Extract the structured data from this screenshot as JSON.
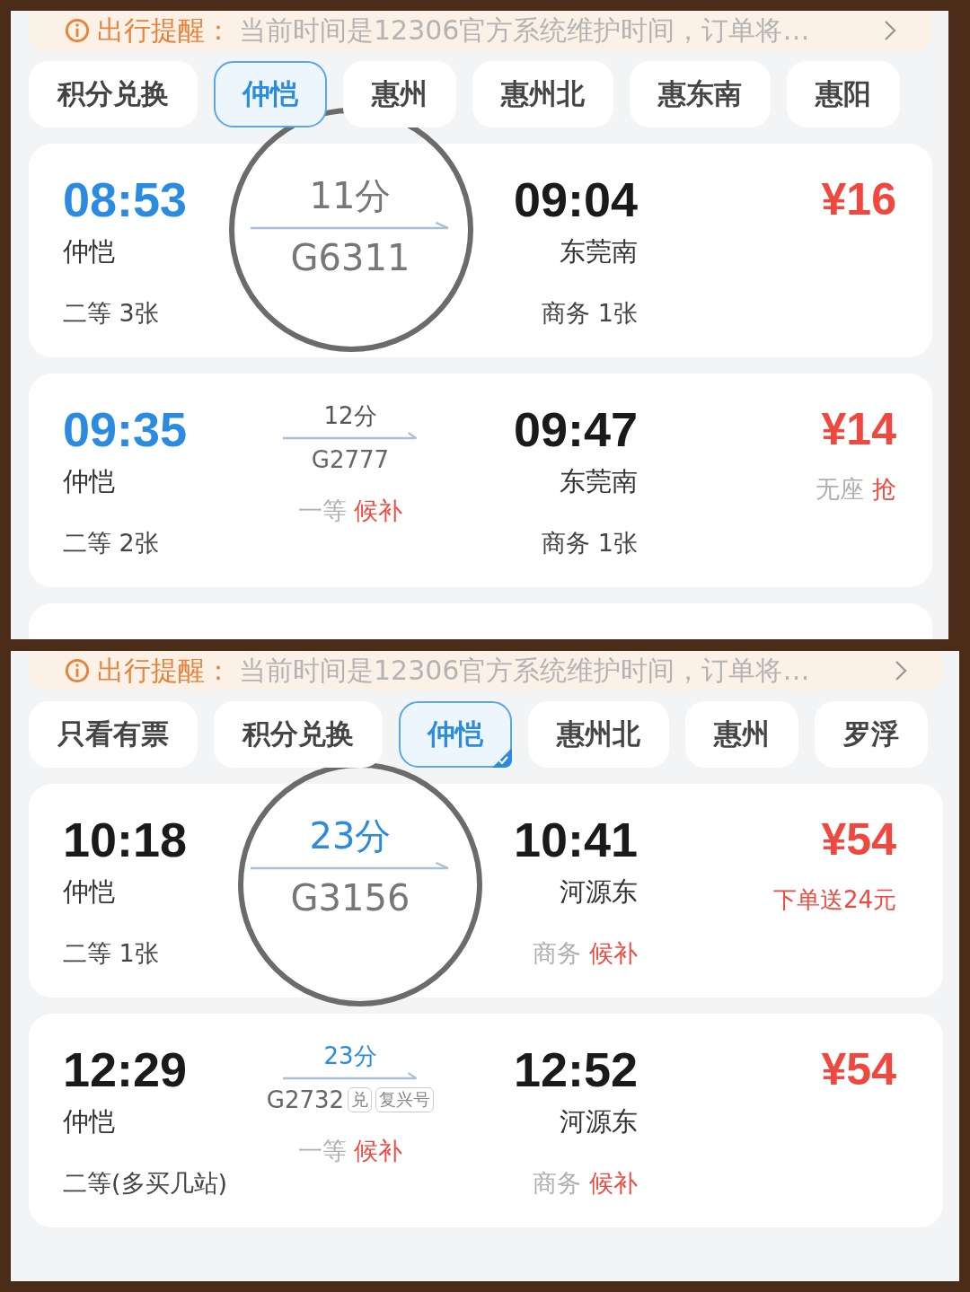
{
  "panels": [
    {
      "notice": {
        "label": "出行提醒：",
        "text": "当前时间是12306官方系统维护时间，订单将…"
      },
      "tabs": [
        {
          "label": "积分兑换",
          "selected": false,
          "badge": false
        },
        {
          "label": "仲恺",
          "selected": true,
          "badge": false
        },
        {
          "label": "惠州",
          "selected": false,
          "badge": false
        },
        {
          "label": "惠州北",
          "selected": false,
          "badge": false
        },
        {
          "label": "惠东南",
          "selected": false,
          "badge": false
        },
        {
          "label": "惠阳",
          "selected": false,
          "badge": false
        }
      ],
      "trains": [
        {
          "kind": "train",
          "zoomed": true,
          "depart": {
            "time": "08:53",
            "station": "仲恺",
            "origin": true,
            "seat": {
              "class": "二等",
              "status": "3张",
              "waitlist": false
            }
          },
          "duration": "11分",
          "duration_highlight": false,
          "number": "G6311",
          "arrive": {
            "time": "09:04",
            "station": "东莞南",
            "seat": {
              "class": "商务",
              "status": "1张",
              "waitlist": false
            }
          },
          "price": "¥16"
        },
        {
          "kind": "train",
          "zoomed": false,
          "depart": {
            "time": "09:35",
            "station": "仲恺",
            "origin": true,
            "seat": {
              "class": "二等",
              "status": "2张",
              "waitlist": false
            }
          },
          "duration": "12分",
          "duration_highlight": false,
          "number": "G2777",
          "middle_seat": {
            "class": "一等",
            "status": "候补",
            "waitlist": true
          },
          "arrive": {
            "time": "09:47",
            "station": "东莞南",
            "seat": {
              "class": "商务",
              "status": "1张",
              "waitlist": false
            }
          },
          "price": "¥14",
          "price_note": {
            "kind": "seat",
            "class": "无座",
            "status": "抢",
            "waitlist": true
          }
        },
        {
          "kind": "stub"
        }
      ]
    },
    {
      "notice": {
        "label": "出行提醒：",
        "text": "当前时间是12306官方系统维护时间，订单将…"
      },
      "tabs": [
        {
          "label": "只看有票",
          "selected": false,
          "badge": false
        },
        {
          "label": "积分兑换",
          "selected": false,
          "badge": false
        },
        {
          "label": "仲恺",
          "selected": true,
          "badge": true
        },
        {
          "label": "惠州北",
          "selected": false,
          "badge": false
        },
        {
          "label": "惠州",
          "selected": false,
          "badge": false
        },
        {
          "label": "罗浮",
          "selected": false,
          "badge": false
        }
      ],
      "trains": [
        {
          "kind": "train",
          "zoomed": true,
          "depart": {
            "time": "10:18",
            "station": "仲恺",
            "origin": false,
            "seat": {
              "class": "二等",
              "status": "1张",
              "waitlist": false
            }
          },
          "duration": "23分",
          "duration_highlight": true,
          "number": "G3156",
          "arrive": {
            "time": "10:41",
            "station": "河源东",
            "seat": {
              "class": "商务",
              "status": "候补",
              "waitlist": true
            }
          },
          "price": "¥54",
          "price_note": {
            "kind": "promo",
            "text": "下单送24元"
          }
        },
        {
          "kind": "train",
          "zoomed": false,
          "depart": {
            "time": "12:29",
            "station": "仲恺",
            "origin": false,
            "seat": {
              "class": "二等(多买几站)",
              "waitlist": false
            }
          },
          "duration": "23分",
          "duration_highlight": true,
          "number": "G2732",
          "tags": [
            "兑",
            "复兴号"
          ],
          "middle_seat": {
            "class": "一等",
            "status": "候补",
            "waitlist": true
          },
          "arrive": {
            "time": "12:52",
            "station": "河源东",
            "seat": {
              "class": "商务",
              "status": "候补",
              "waitlist": true
            }
          },
          "price": "¥54"
        }
      ]
    }
  ]
}
